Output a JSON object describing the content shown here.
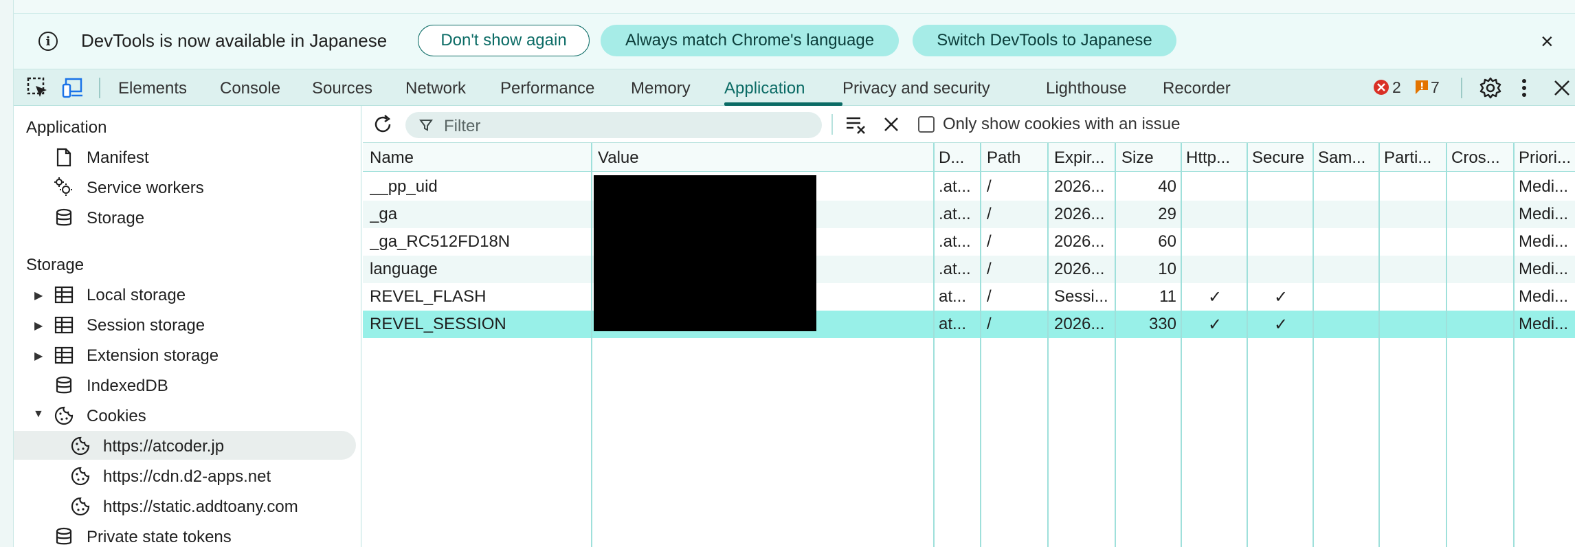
{
  "infobar": {
    "message": "DevTools is now available in Japanese",
    "dont_show_label": "Don't show again",
    "always_match_label": "Always match Chrome's language",
    "switch_label": "Switch DevTools to Japanese",
    "close_glyph": "×"
  },
  "tabs": {
    "elements": "Elements",
    "console": "Console",
    "sources": "Sources",
    "network": "Network",
    "performance": "Performance",
    "memory": "Memory",
    "application": "Application",
    "privacy": "Privacy and security",
    "lighthouse": "Lighthouse",
    "recorder": "Recorder",
    "active": "Application",
    "error_count": "2",
    "warning_count": "7"
  },
  "sidebar": {
    "application_header": "Application",
    "manifest": "Manifest",
    "service_workers": "Service workers",
    "storage_item": "Storage",
    "storage_header": "Storage",
    "local_storage": "Local storage",
    "session_storage": "Session storage",
    "extension_storage": "Extension storage",
    "indexeddb": "IndexedDB",
    "cookies": "Cookies",
    "cookie_origins": [
      "https://atcoder.jp",
      "https://cdn.d2-apps.net",
      "https://static.addtoany.com"
    ],
    "private_state_tokens": "Private state tokens"
  },
  "toolbar": {
    "filter_placeholder": "Filter",
    "only_issue_label": "Only show cookies with an issue"
  },
  "table": {
    "headers": [
      "Name",
      "Value",
      "D...",
      "Path",
      "Expir...",
      "Size",
      "Http...",
      "Secure",
      "Sam...",
      "Parti...",
      "Cros...",
      "Priori..."
    ],
    "rows": [
      {
        "name": "__pp_uid",
        "domain": ".at...",
        "path": "/",
        "expires": "2026...",
        "size": "40",
        "http": "",
        "secure": "",
        "priority": "Medi..."
      },
      {
        "name": "_ga",
        "domain": ".at...",
        "path": "/",
        "expires": "2026...",
        "size": "29",
        "http": "",
        "secure": "",
        "priority": "Medi..."
      },
      {
        "name": "_ga_RC512FD18N",
        "domain": ".at...",
        "path": "/",
        "expires": "2026...",
        "size": "60",
        "http": "",
        "secure": "",
        "priority": "Medi..."
      },
      {
        "name": "language",
        "domain": ".at...",
        "path": "/",
        "expires": "2026...",
        "size": "10",
        "http": "",
        "secure": "",
        "priority": "Medi..."
      },
      {
        "name": "REVEL_FLASH",
        "domain": "at...",
        "path": "/",
        "expires": "Sessi...",
        "size": "11",
        "http": "✓",
        "secure": "✓",
        "priority": "Medi..."
      },
      {
        "name": "REVEL_SESSION",
        "domain": "at...",
        "path": "/",
        "expires": "2026...",
        "size": "330",
        "http": "✓",
        "secure": "✓",
        "priority": "Medi..."
      }
    ],
    "selected_row": "REVEL_SESSION"
  },
  "colors": {
    "accent": "#0b6b65",
    "selected_row": "#98f0e8",
    "pill_filled": "#a6ece7",
    "error": "#d93025",
    "warning": "#e37400"
  }
}
